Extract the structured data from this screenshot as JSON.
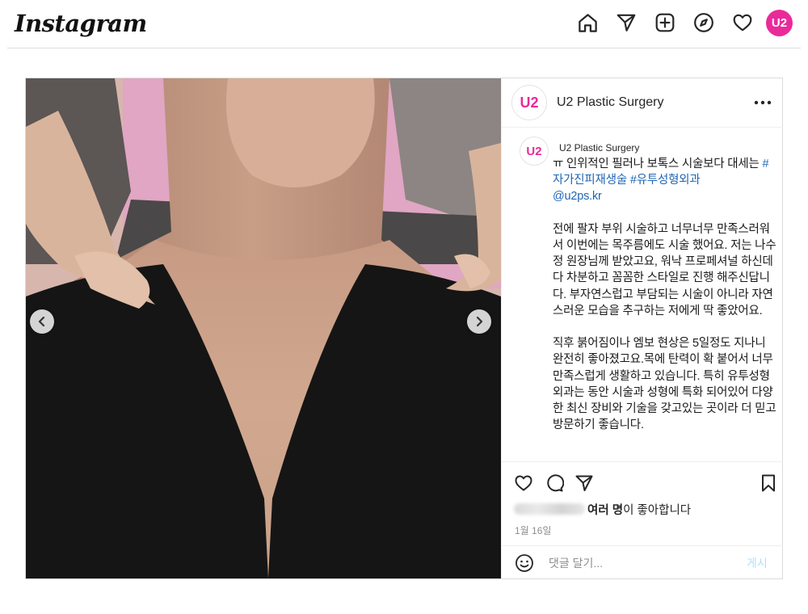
{
  "nav": {
    "logo": "Instagram",
    "avatar_text": "U2",
    "icons": [
      "home-icon",
      "direct-icon",
      "new-post-icon",
      "explore-icon",
      "activity-icon"
    ]
  },
  "post": {
    "account_name": "U2 Plastic Surgery",
    "avatar_text": "U2",
    "caption": {
      "username": "U2 Plastic Surgery",
      "line1_plain": "ㅠ 인위적인 필러나 보톡스 시술보다 대세는 ",
      "hashtag1": "#자가진피재생술",
      "hashtag2": "#유투성형외과",
      "mention": "@u2ps.kr",
      "paragraph1": "전에 팔자 부위 시술하고 너무너무 만족스러워서 이번에는 목주름에도 시술 했어요. 저는 나수정 원장님께 받았고요, 워낙 프로페셔널 하신데다 차분하고 꼼꼼한 스타일로 진행 해주신답니다. 부자연스럽고 부담되는 시술이 아니라 자연스러운 모습을 추구하는 저에게 딱 좋았어요.",
      "paragraph2": "직후 붉어짐이나 엠보 현상은 5일정도 지나니 완전히 좋아졌고요.목에 탄력이 확 붙어서 너무 만족스럽게 생활하고 있습니다. 특히 유투성형외과는 동안 시술과 성형에 특화 되어있어 다양한 최신 장비와 기술을 갖고있는 곳이라 더 믿고 방문하기 좋습니다."
    },
    "likes_bold": "여러 명",
    "likes_rest": "이 좋아합니다",
    "date": "1월 16일",
    "comment_placeholder": "댓글 달기...",
    "post_button": "게시"
  },
  "colors": {
    "brand": "#ea2a9a",
    "link": "#1f66b3",
    "post_button_disabled": "#b2dffc",
    "meta_text": "#8e8e8e"
  }
}
